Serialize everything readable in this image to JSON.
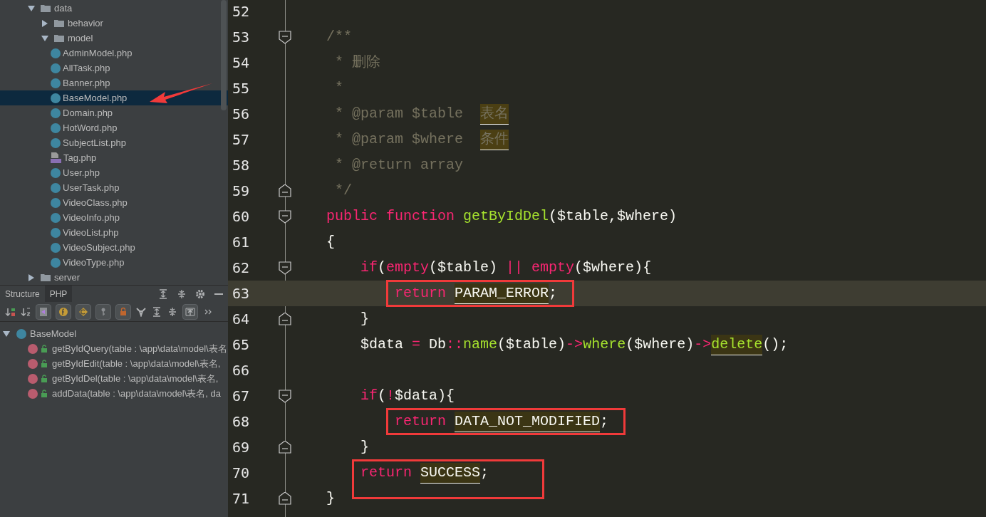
{
  "project_tree": {
    "items": [
      {
        "label": "data",
        "kind": "folder",
        "expanded": true,
        "selected": false,
        "children": [
          {
            "label": "behavior",
            "kind": "folder",
            "expanded": false,
            "selected": false
          },
          {
            "label": "model",
            "kind": "folder",
            "expanded": true,
            "selected": false,
            "children": [
              {
                "label": "AdminModel.php",
                "kind": "class",
                "selected": false
              },
              {
                "label": "AllTask.php",
                "kind": "class",
                "selected": false
              },
              {
                "label": "Banner.php",
                "kind": "class",
                "selected": false
              },
              {
                "label": "BaseModel.php",
                "kind": "class",
                "selected": true
              },
              {
                "label": "Domain.php",
                "kind": "class",
                "selected": false
              },
              {
                "label": "HotWord.php",
                "kind": "class",
                "selected": false
              },
              {
                "label": "SubjectList.php",
                "kind": "class",
                "selected": false
              },
              {
                "label": "Tag.php",
                "kind": "php",
                "selected": false
              },
              {
                "label": "User.php",
                "kind": "class",
                "selected": false
              },
              {
                "label": "UserTask.php",
                "kind": "class",
                "selected": false
              },
              {
                "label": "VideoClass.php",
                "kind": "class",
                "selected": false
              },
              {
                "label": "VideoInfo.php",
                "kind": "class",
                "selected": false
              },
              {
                "label": "VideoList.php",
                "kind": "class",
                "selected": false
              },
              {
                "label": "VideoSubject.php",
                "kind": "class",
                "selected": false
              },
              {
                "label": "VideoType.php",
                "kind": "class",
                "selected": false
              }
            ]
          }
        ]
      },
      {
        "label": "server",
        "kind": "folder",
        "expanded": false,
        "selected": false
      }
    ]
  },
  "structure": {
    "tabs": [
      {
        "label": "Structure",
        "selected": false
      },
      {
        "label": "PHP",
        "selected": true
      }
    ],
    "root": {
      "label": "BaseModel",
      "expanded": true,
      "members": [
        {
          "label": "getByIdQuery(table : \\app\\data\\model\\表名"
        },
        {
          "label": "getByIdEdit(table : \\app\\data\\model\\表名,"
        },
        {
          "label": "getByIdDel(table : \\app\\data\\model\\表名, "
        },
        {
          "label": "addData(table : \\app\\data\\model\\表名, da"
        }
      ]
    }
  },
  "editor": {
    "lines": [
      {
        "number": "52"
      },
      {
        "number": "53",
        "fold_start": true,
        "tokens": [
          {
            "t": "/**",
            "kind": "comment"
          }
        ]
      },
      {
        "number": "54",
        "tokens": [
          {
            "t": " * 删除",
            "kind": "comment"
          }
        ]
      },
      {
        "number": "55",
        "tokens": [
          {
            "t": " *",
            "kind": "comment"
          }
        ]
      },
      {
        "number": "56",
        "tokens": [
          {
            "t": " * @param $table  ",
            "kind": "comment"
          },
          {
            "t": "表名",
            "kind": "comment-mark"
          }
        ]
      },
      {
        "number": "57",
        "tokens": [
          {
            "t": " * @param $where  ",
            "kind": "comment"
          },
          {
            "t": "条件",
            "kind": "comment-mark"
          }
        ]
      },
      {
        "number": "58",
        "tokens": [
          {
            "t": " * @return array",
            "kind": "comment"
          }
        ]
      },
      {
        "number": "59",
        "fold_end": true,
        "tokens": [
          {
            "t": " */",
            "kind": "comment"
          }
        ]
      },
      {
        "number": "60",
        "fold_start": true,
        "tokens": [
          {
            "t": "public function ",
            "kind": "keyword"
          },
          {
            "t": "getByIdDel",
            "kind": "func"
          },
          {
            "t": "($table,$where)",
            "kind": "plain"
          }
        ]
      },
      {
        "number": "61",
        "tokens": [
          {
            "t": "{",
            "kind": "plain"
          }
        ]
      },
      {
        "number": "62",
        "fold_start": true,
        "tokens": [
          {
            "t": "    if",
            "kind": "keyword"
          },
          {
            "t": "(",
            "kind": "plain"
          },
          {
            "t": "empty",
            "kind": "keyword"
          },
          {
            "t": "($table) ",
            "kind": "plain"
          },
          {
            "t": "|| ",
            "kind": "keyword"
          },
          {
            "t": "empty",
            "kind": "keyword"
          },
          {
            "t": "($where){",
            "kind": "plain"
          }
        ]
      },
      {
        "number": "63",
        "current": true,
        "boxed": true,
        "tokens": [
          {
            "t": "        return ",
            "kind": "keyword"
          },
          {
            "t": "PARAM_ERROR",
            "kind": "const"
          },
          {
            "t": ";",
            "kind": "plain"
          }
        ]
      },
      {
        "number": "64",
        "fold_end": true,
        "tokens": [
          {
            "t": "    }",
            "kind": "plain"
          }
        ]
      },
      {
        "number": "65",
        "tokens": [
          {
            "t": "    $data ",
            "kind": "plain"
          },
          {
            "t": "=",
            "kind": "keyword"
          },
          {
            "t": " Db",
            "kind": "plain"
          },
          {
            "t": "::",
            "kind": "keyword"
          },
          {
            "t": "name",
            "kind": "func"
          },
          {
            "t": "($table)",
            "kind": "plain"
          },
          {
            "t": "->",
            "kind": "keyword"
          },
          {
            "t": "where",
            "kind": "func"
          },
          {
            "t": "($where)",
            "kind": "plain"
          },
          {
            "t": "->",
            "kind": "keyword"
          },
          {
            "t": "delete",
            "kind": "func-mark"
          },
          {
            "t": "();",
            "kind": "plain"
          }
        ]
      },
      {
        "number": "66"
      },
      {
        "number": "67",
        "fold_start": true,
        "tokens": [
          {
            "t": "    if",
            "kind": "keyword"
          },
          {
            "t": "(",
            "kind": "plain"
          },
          {
            "t": "!",
            "kind": "keyword"
          },
          {
            "t": "$data){",
            "kind": "plain"
          }
        ]
      },
      {
        "number": "68",
        "boxed": true,
        "tokens": [
          {
            "t": "        return ",
            "kind": "keyword"
          },
          {
            "t": "DATA_NOT_MODIFIED",
            "kind": "const"
          },
          {
            "t": ";",
            "kind": "plain"
          }
        ]
      },
      {
        "number": "69",
        "fold_end": true,
        "tokens": [
          {
            "t": "    }",
            "kind": "plain"
          }
        ]
      },
      {
        "number": "70",
        "boxed": true,
        "box_spans_next_line": true,
        "tokens": [
          {
            "t": "    return ",
            "kind": "keyword"
          },
          {
            "t": "SUCCESS",
            "kind": "const"
          },
          {
            "t": ";",
            "kind": "plain"
          }
        ]
      },
      {
        "number": "71",
        "fold_end": true,
        "tokens": [
          {
            "t": "}",
            "kind": "plain"
          }
        ]
      }
    ]
  }
}
